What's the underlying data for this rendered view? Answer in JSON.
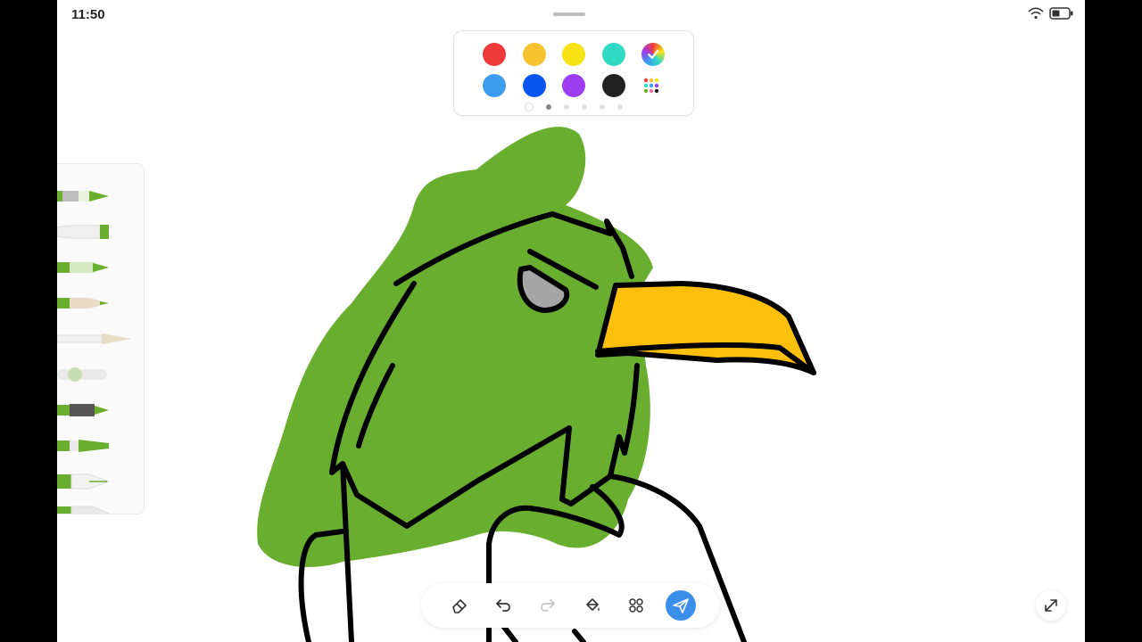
{
  "status_bar": {
    "time": "11:50",
    "wifi_icon": "wifi-icon",
    "battery_icon": "battery-icon"
  },
  "palette": {
    "row1": [
      {
        "name": "red",
        "color": "#f03a3a"
      },
      {
        "name": "amber",
        "color": "#f7c22f"
      },
      {
        "name": "yellow",
        "color": "#f7e315"
      },
      {
        "name": "teal",
        "color": "#2fd9c4"
      },
      {
        "name": "custom-picker",
        "color": "gradient"
      }
    ],
    "row2": [
      {
        "name": "sky-blue",
        "color": "#3d9cf0"
      },
      {
        "name": "blue",
        "color": "#0a55f0"
      },
      {
        "name": "purple",
        "color": "#9d3df0"
      },
      {
        "name": "black",
        "color": "#222222"
      },
      {
        "name": "more-colors",
        "color": "multi"
      }
    ],
    "pages": 5,
    "active_page": 1
  },
  "tool_panel": {
    "accent_color": "#6aae2f",
    "tools": [
      "pencil",
      "ballpoint-pen",
      "fineliner",
      "crayon",
      "brush",
      "airbrush",
      "marker",
      "highlighter",
      "fountain-pen",
      "calligraphy-pen"
    ]
  },
  "bottom_toolbar": {
    "buttons": [
      "eraser-icon",
      "undo-icon",
      "redo-icon",
      "fill-bucket-icon",
      "apps-grid-icon",
      "send-icon"
    ],
    "send_color": "#3b8eea"
  },
  "canvas": {
    "fill_color": "#6aae2f",
    "beak_color": "#fcc00c",
    "eye_color": "#a6a6a6",
    "outline_color": "#000000"
  }
}
